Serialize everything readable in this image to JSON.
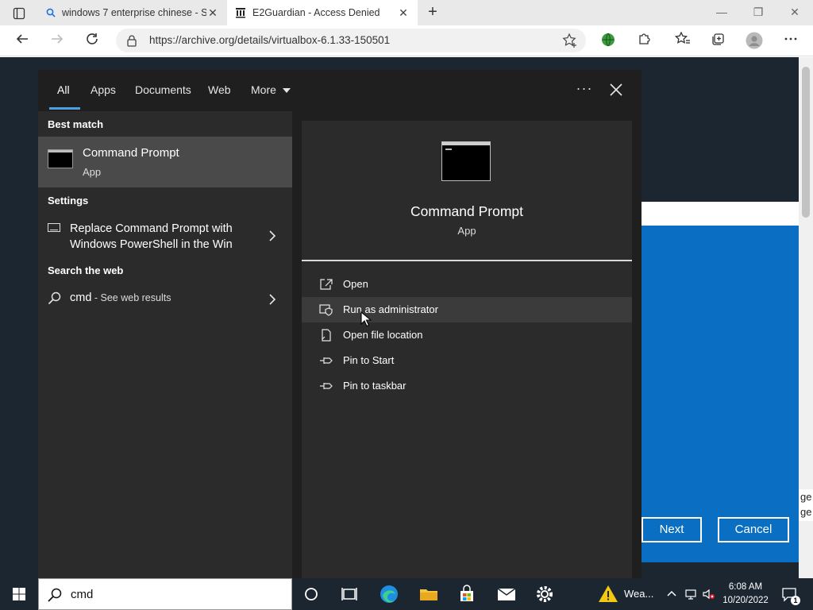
{
  "browser": {
    "tabs": [
      {
        "title": "windows 7 enterprise chinese - S",
        "close": "✕"
      },
      {
        "title": "E2Guardian - Access Denied",
        "close": "✕"
      }
    ],
    "new_tab": "+",
    "window_controls": {
      "minimize": "—",
      "restore": "❐",
      "close": "✕"
    },
    "address": {
      "url": "https://archive.org/details/virtualbox-6.1.33-150501"
    }
  },
  "page": {
    "dialog": {
      "next_label": "Next",
      "cancel_label": "Cancel"
    },
    "edge_text": "ge ge"
  },
  "search_panel": {
    "tabs": [
      {
        "label": "All",
        "active": true
      },
      {
        "label": "Apps"
      },
      {
        "label": "Documents"
      },
      {
        "label": "Web"
      },
      {
        "label": "More"
      }
    ],
    "dots": "···",
    "best_match": {
      "header": "Best match",
      "name": "Command Prompt",
      "type": "App"
    },
    "settings": {
      "header": "Settings",
      "item": "Replace Command Prompt with Windows PowerShell in the Win"
    },
    "web": {
      "header": "Search the web",
      "query": "cmd",
      "suffix": " - See web results"
    },
    "preview": {
      "name": "Command Prompt",
      "type": "App",
      "actions": [
        {
          "label": "Open",
          "icon": "open-icon"
        },
        {
          "label": "Run as administrator",
          "icon": "shield-icon",
          "hover": true
        },
        {
          "label": "Open file location",
          "icon": "file-location-icon"
        },
        {
          "label": "Pin to Start",
          "icon": "pin-icon"
        },
        {
          "label": "Pin to taskbar",
          "icon": "pin-icon"
        }
      ]
    }
  },
  "taskbar": {
    "search_query": "cmd",
    "weather_label": "Wea...",
    "clock": {
      "time": "6:08 AM",
      "date": "10/20/2022"
    },
    "notification_count": "1"
  },
  "colors": {
    "accent": "#4ca0e0",
    "dialog_blue": "#0a6fc2",
    "panel_dark": "#1f1f1f",
    "panel_mid": "#2b2b2b",
    "taskbar": "#1c2631"
  }
}
